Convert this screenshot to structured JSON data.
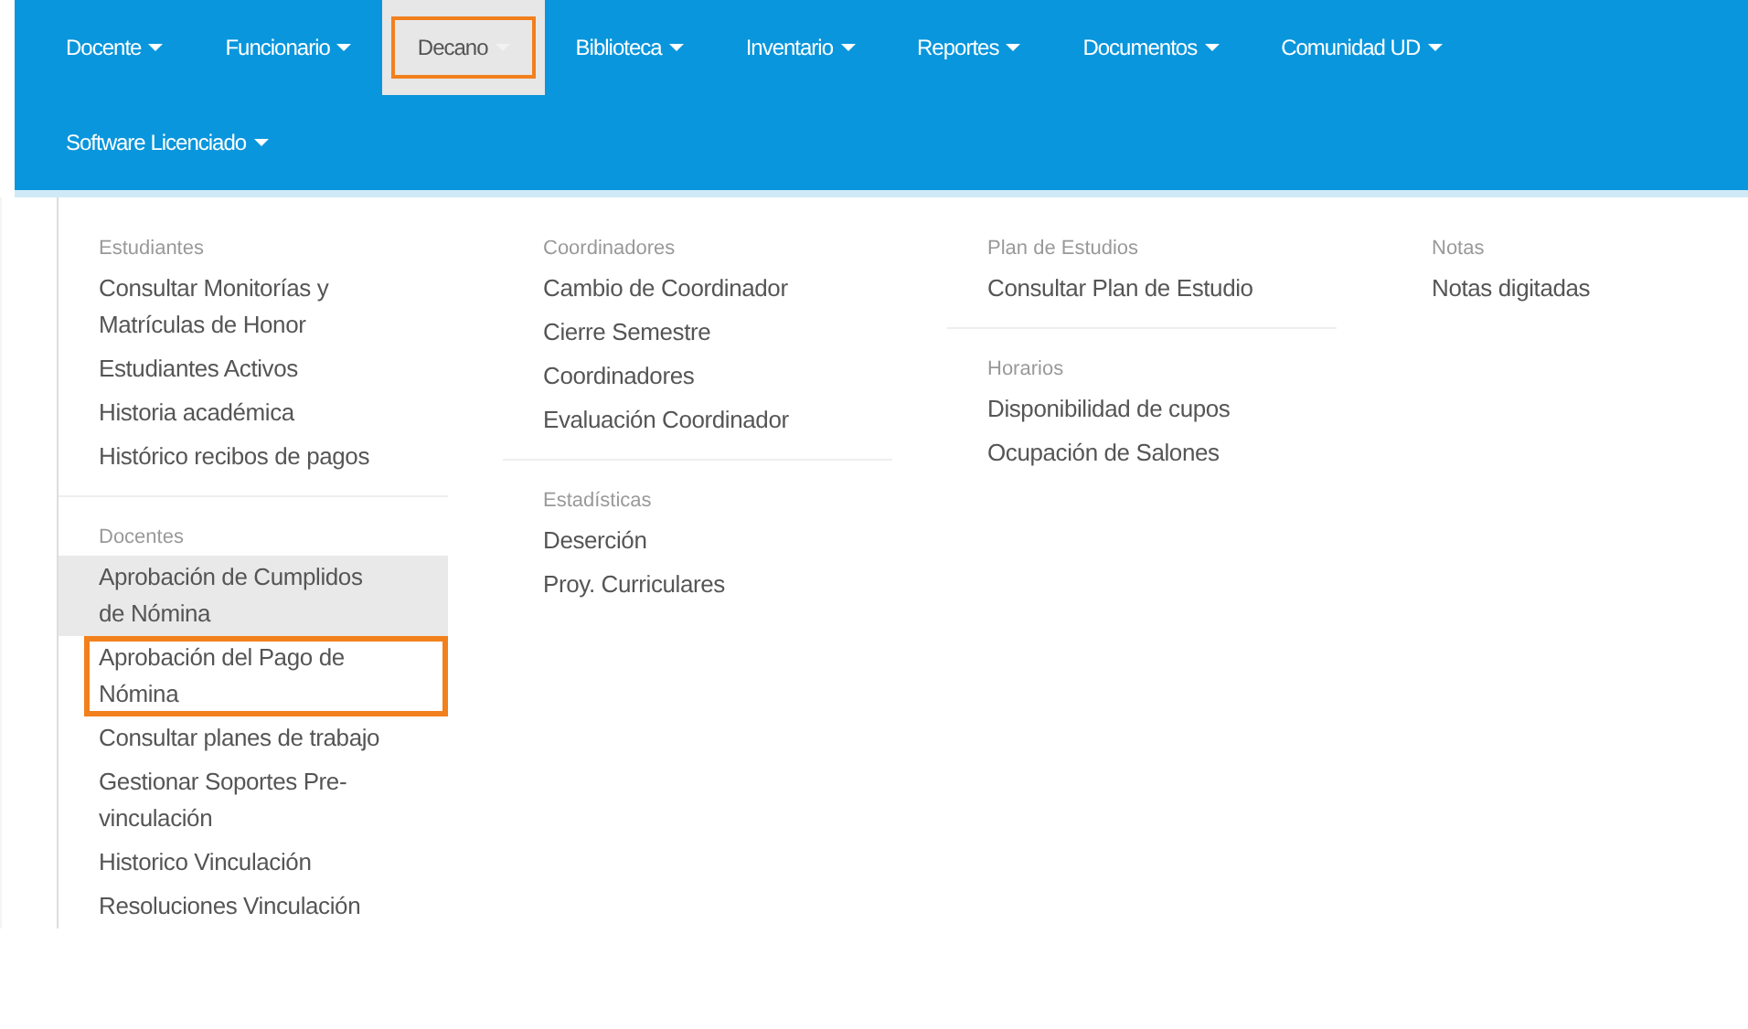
{
  "navbar": {
    "items": [
      {
        "label": "Docente",
        "selected": false,
        "highlighted": false
      },
      {
        "label": "Funcionario",
        "selected": false,
        "highlighted": false
      },
      {
        "label": "Decano",
        "selected": true,
        "highlighted": true
      },
      {
        "label": "Biblioteca",
        "selected": false,
        "highlighted": false
      },
      {
        "label": "Inventario",
        "selected": false,
        "highlighted": false
      },
      {
        "label": "Reportes",
        "selected": false,
        "highlighted": false
      },
      {
        "label": "Documentos",
        "selected": false,
        "highlighted": false
      },
      {
        "label": "Comunidad UD",
        "selected": false,
        "highlighted": false
      },
      {
        "label": "Software Licenciado",
        "selected": false,
        "highlighted": false
      }
    ]
  },
  "dropdown": {
    "columns": [
      {
        "groups": [
          {
            "heading": "Estudiantes",
            "items": [
              {
                "label": "Consultar Monitorías y Matrículas de Honor",
                "hovered": false,
                "highlighted": false
              },
              {
                "label": "Estudiantes Activos",
                "hovered": false,
                "highlighted": false
              },
              {
                "label": "Historia académica",
                "hovered": false,
                "highlighted": false
              },
              {
                "label": "Histórico recibos de pagos",
                "hovered": false,
                "highlighted": false
              }
            ]
          },
          {
            "heading": "Docentes",
            "items": [
              {
                "label": "Aprobación de Cumplidos de Nómina",
                "hovered": true,
                "highlighted": false
              },
              {
                "label": "Aprobación del Pago de Nómina",
                "hovered": false,
                "highlighted": true
              },
              {
                "label": "Consultar planes de trabajo",
                "hovered": false,
                "highlighted": false
              },
              {
                "label": "Gestionar Soportes Pre-vinculación",
                "hovered": false,
                "highlighted": false
              },
              {
                "label": "Historico Vinculación",
                "hovered": false,
                "highlighted": false
              },
              {
                "label": "Resoluciones Vinculación",
                "hovered": false,
                "highlighted": false
              }
            ]
          }
        ]
      },
      {
        "groups": [
          {
            "heading": "Coordinadores",
            "items": [
              {
                "label": "Cambio de Coordinador",
                "hovered": false,
                "highlighted": false
              },
              {
                "label": "Cierre Semestre",
                "hovered": false,
                "highlighted": false
              },
              {
                "label": "Coordinadores",
                "hovered": false,
                "highlighted": false
              },
              {
                "label": "Evaluación Coordinador",
                "hovered": false,
                "highlighted": false
              }
            ]
          },
          {
            "heading": "Estadísticas",
            "items": [
              {
                "label": "Deserción",
                "hovered": false,
                "highlighted": false
              },
              {
                "label": "Proy. Curriculares",
                "hovered": false,
                "highlighted": false
              }
            ]
          }
        ]
      },
      {
        "groups": [
          {
            "heading": "Plan de Estudios",
            "items": [
              {
                "label": "Consultar Plan de Estudio",
                "hovered": false,
                "highlighted": false
              }
            ]
          },
          {
            "heading": "Horarios",
            "items": [
              {
                "label": "Disponibilidad de cupos",
                "hovered": false,
                "highlighted": false
              },
              {
                "label": "Ocupación de Salones",
                "hovered": false,
                "highlighted": false
              }
            ]
          }
        ]
      },
      {
        "groups": [
          {
            "heading": "Notas",
            "items": [
              {
                "label": "Notas digitadas",
                "hovered": false,
                "highlighted": false
              }
            ]
          }
        ]
      }
    ]
  }
}
